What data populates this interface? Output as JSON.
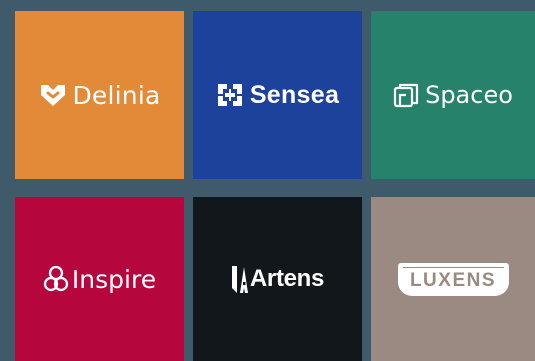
{
  "tiles": [
    {
      "name": "Delinia",
      "color": "#e38a38",
      "icon": "heart-box-icon"
    },
    {
      "name": "Sensea",
      "color": "#1d429c",
      "icon": "s-monogram-icon"
    },
    {
      "name": "Spaceo",
      "color": "#26826a",
      "icon": "stacked-pages-icon"
    },
    {
      "name": "Inspire",
      "color": "#b5063e",
      "icon": "knot-icon"
    },
    {
      "name": "Artens",
      "color": "#12171b",
      "icon": "a-block-icon"
    },
    {
      "name": "LUXENS",
      "color": "#9a8a81",
      "icon": "badge-frame-icon"
    }
  ]
}
